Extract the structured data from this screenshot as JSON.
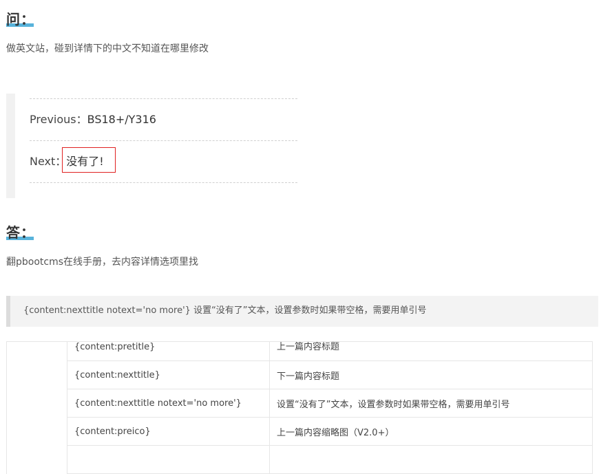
{
  "question": {
    "heading": "问：",
    "text": "做英文站，碰到详情下的中文不知道在哪里修改"
  },
  "nav": {
    "prev_label": "Previous：",
    "prev_value": "BS18+/Y316",
    "next_label": "Next：",
    "next_value": "没有了!"
  },
  "answer": {
    "heading": "答：",
    "text": "翻pbootcms在线手册，去内容详情选项里找"
  },
  "code_note": "{content:nexttitle notext='no more'} 设置“没有了”文本，设置参数时如果带空格，需要用单引号",
  "table": {
    "rows": [
      {
        "tag": "{content:pretitle}",
        "desc": "上一篇内容标题"
      },
      {
        "tag": "{content:nexttitle}",
        "desc": "下一篇内容标题"
      },
      {
        "tag": "{content:nexttitle notext='no more'}",
        "desc": "设置“没有了”文本，设置参数时如果带空格，需要用单引号"
      },
      {
        "tag": "{content:preico}",
        "desc": "上一篇内容缩略图（V2.0+）"
      },
      {
        "tag": "",
        "desc": ""
      }
    ]
  },
  "colors": {
    "heading_underline": "#58b3db",
    "highlight_border": "#e02020"
  }
}
